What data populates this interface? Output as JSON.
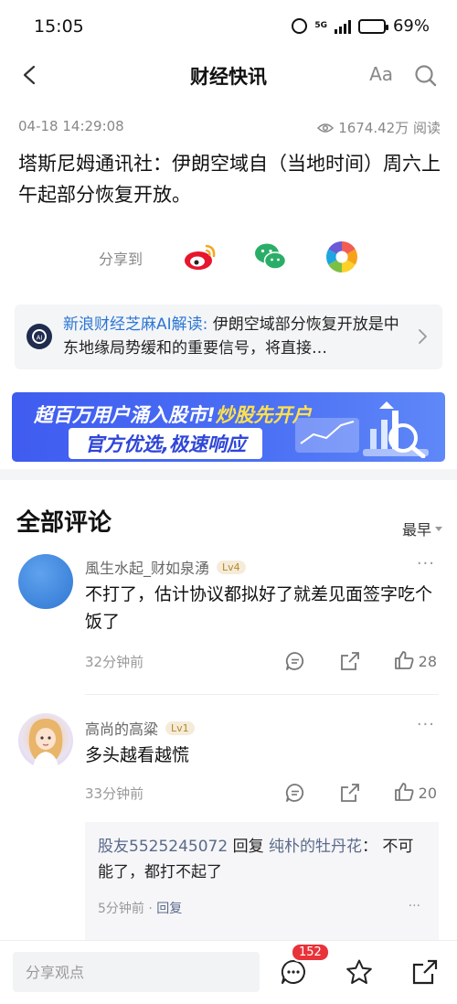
{
  "status_bar": {
    "time": "15:05",
    "network": "5G",
    "battery": "69%",
    "battery_level": 0.69
  },
  "nav": {
    "title": "财经快讯",
    "font_button": "Aa"
  },
  "article": {
    "datetime": "04-18 14:29:08",
    "views": "1674.42万 阅读",
    "headline": "塔斯尼姆通讯社：伊朗空域自（当地时间）周六上午起部分恢复开放。"
  },
  "share": {
    "label": "分享到",
    "targets": [
      "weibo",
      "wechat",
      "moments"
    ]
  },
  "ai_summary": {
    "source": "新浪财经芝麻AI解读:",
    "text": " 伊朗空域部分恢复开放是中东地缘局势缓和的重要信号，将直接…"
  },
  "banner": {
    "line1_part1": "超百万用户涌入股市!",
    "line1_part2": "炒股先开户",
    "line2": "官方优选,极速响应"
  },
  "comments_section": {
    "title": "全部评论",
    "sort_label": "最早",
    "comments": [
      {
        "username": "風生水起_财如泉湧",
        "level": "Lv4",
        "text": "不打了，估计协议都拟好了就差见面签字吃个饭了",
        "time": "32分钟前",
        "likes": "28"
      },
      {
        "username": "高尚的高粱",
        "level": "Lv1",
        "text": "多头越看越慌",
        "time": "33分钟前",
        "likes": "20",
        "reply": {
          "author": "股友5525245072",
          "verb": " 回复 ",
          "target": "纯朴的牡丹花",
          "text": "： 不可能了，都打不起了",
          "time": "5分钟前",
          "reply_label": "回复"
        }
      }
    ]
  },
  "bottom_bar": {
    "input_placeholder": "分享观点",
    "comment_count": "152"
  },
  "colors": {
    "link_blue": "#2b76d6",
    "badge_red": "#e8333a",
    "banner_blue": "#3f5cf0"
  }
}
